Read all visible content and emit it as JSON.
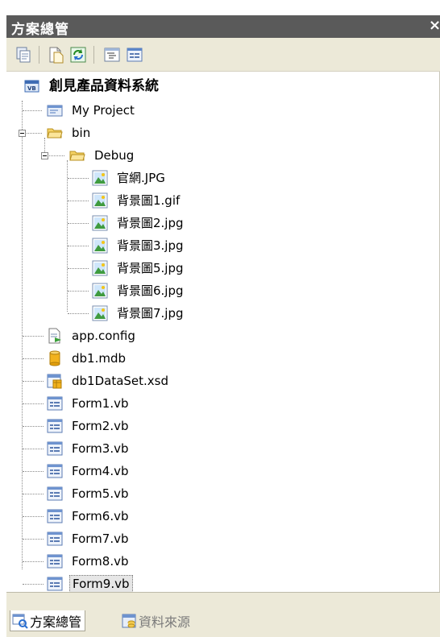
{
  "window": {
    "title": "方案總管",
    "close_glyph": "×"
  },
  "toolbar": {
    "buttons": [
      {
        "name": "properties-button",
        "icon": "properties-icon"
      },
      {
        "name": "show-all-files-button",
        "icon": "show-all-files-icon"
      },
      {
        "name": "refresh-button",
        "icon": "refresh-icon"
      },
      {
        "name": "view-code-button",
        "icon": "view-code-icon"
      },
      {
        "name": "view-designer-button",
        "icon": "view-designer-icon"
      }
    ]
  },
  "tree": {
    "root": {
      "label": "創見產品資料系統",
      "icon": "vb-project-icon"
    },
    "my_project": {
      "label": "My Project",
      "icon": "my-project-icon"
    },
    "bin": {
      "label": "bin",
      "icon": "folder-open-icon"
    },
    "debug": {
      "label": "Debug",
      "icon": "folder-open-icon"
    },
    "debug_files": [
      {
        "label": "官網.JPG",
        "icon": "image-file-icon"
      },
      {
        "label": "背景圖1.gif",
        "icon": "image-file-icon"
      },
      {
        "label": "背景圖2.jpg",
        "icon": "image-file-icon"
      },
      {
        "label": "背景圖3.jpg",
        "icon": "image-file-icon"
      },
      {
        "label": "背景圖5.jpg",
        "icon": "image-file-icon"
      },
      {
        "label": "背景圖6.jpg",
        "icon": "image-file-icon"
      },
      {
        "label": "背景圖7.jpg",
        "icon": "image-file-icon"
      }
    ],
    "project_files": [
      {
        "label": "app.config",
        "icon": "config-file-icon"
      },
      {
        "label": "db1.mdb",
        "icon": "database-icon"
      },
      {
        "label": "db1DataSet.xsd",
        "icon": "dataset-icon"
      },
      {
        "label": "Form1.vb",
        "icon": "form-icon"
      },
      {
        "label": "Form2.vb",
        "icon": "form-icon"
      },
      {
        "label": "Form3.vb",
        "icon": "form-icon"
      },
      {
        "label": "Form4.vb",
        "icon": "form-icon"
      },
      {
        "label": "Form5.vb",
        "icon": "form-icon"
      },
      {
        "label": "Form6.vb",
        "icon": "form-icon"
      },
      {
        "label": "Form7.vb",
        "icon": "form-icon"
      },
      {
        "label": "Form8.vb",
        "icon": "form-icon"
      },
      {
        "label": "Form9.vb",
        "icon": "form-icon",
        "selected": true
      }
    ]
  },
  "bottom_tabs": [
    {
      "label": "方案總管",
      "icon": "solution-explorer-icon",
      "active": true
    },
    {
      "label": "資料來源",
      "icon": "data-sources-icon",
      "active": false
    }
  ],
  "colors": {
    "titlebar_bg": "#5a5a5a",
    "toolbar_bg": "#ece9d8",
    "tree_bg": "#ffffff",
    "selection_bg": "#e6e6e6"
  }
}
